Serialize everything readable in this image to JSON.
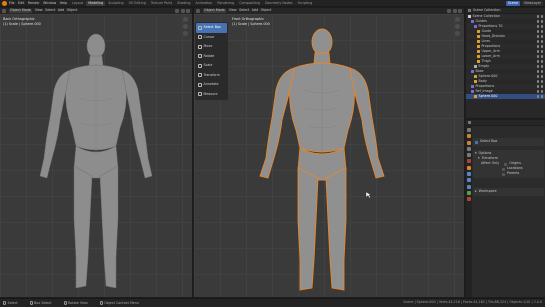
{
  "menu": [
    "File",
    "Edit",
    "Render",
    "Window",
    "Help"
  ],
  "workspace_tabs": [
    "Layout",
    "Modeling",
    "Sculpting",
    "UV Editing",
    "Texture Paint",
    "Shading",
    "Animation",
    "Rendering",
    "Compositing",
    "Geometry Nodes",
    "Scripting"
  ],
  "active_tab": "Modeling",
  "top_right": {
    "scene": "Scene",
    "view_layer": "ViewLayer"
  },
  "left_viewport": {
    "mode": "Object Mode",
    "menus": [
      "View",
      "Select",
      "Add",
      "Object"
    ],
    "view_title": "Back Orthographic",
    "collection": "(1) Scale | Sphere.000"
  },
  "right_viewport": {
    "mode": "Object Mode",
    "menus": [
      "View",
      "Select",
      "Add",
      "Object"
    ],
    "view_title": "Front Orthographic",
    "collection": "(1) Scale | Sphere.000"
  },
  "tools": [
    "Select Box",
    "Cursor",
    "Move",
    "Rotate",
    "Scale",
    "Transform",
    "Annotate",
    "Measure"
  ],
  "active_tool": "Select Box",
  "outliner": {
    "title": "Scene Collection",
    "items": [
      {
        "label": "Scene Collection",
        "color": "#d0d0d0"
      },
      {
        "label": "Guides",
        "color": "#7e6bd1"
      },
      {
        "label": "Proportions 70",
        "color": "#7e6bd1"
      },
      {
        "label": "Guide",
        "color": "#e0a030"
      },
      {
        "label": "Head_Division",
        "color": "#e0a030"
      },
      {
        "label": "Lines",
        "color": "#e0a030"
      },
      {
        "label": "Proportions",
        "color": "#e0a030"
      },
      {
        "label": "Upper_Arm",
        "color": "#e0a030"
      },
      {
        "label": "Lower_Arm",
        "color": "#e0a030"
      },
      {
        "label": "Thigh",
        "color": "#e0a030"
      },
      {
        "label": "Empty",
        "color": "#b0b0b0"
      },
      {
        "label": "Base",
        "color": "#7e6bd1"
      },
      {
        "label": "Sphere.000",
        "color": "#e0a030"
      },
      {
        "label": "Body",
        "color": "#e0a030"
      },
      {
        "label": "Proportions",
        "color": "#7e6bd1"
      },
      {
        "label": "Ref_Image",
        "color": "#7e6bd1"
      },
      {
        "label": "Sphere.000",
        "color": "#e0a030",
        "selected": true
      }
    ]
  },
  "properties": {
    "section_select": "Select Box",
    "options_title": "Options",
    "transform_title": "Transform",
    "affect_only": "Affect Only",
    "checks": [
      "Origins",
      "Locations",
      "Parents"
    ],
    "workspace_title": "Workspace"
  },
  "status": {
    "select": "Select",
    "box_select": "Box Select",
    "rotate_view": "Rotate View",
    "context_menu": "Object Context Menu",
    "info": "Scene | Sphere.000 | Verts:44,218 | Faces:44,162 | Tris:88,324 | Objects:1/10 | 3.0.0"
  },
  "colors": {
    "accent": "#4772b3",
    "selection_outline": "#e8862a",
    "body": "#8e8e8e"
  }
}
